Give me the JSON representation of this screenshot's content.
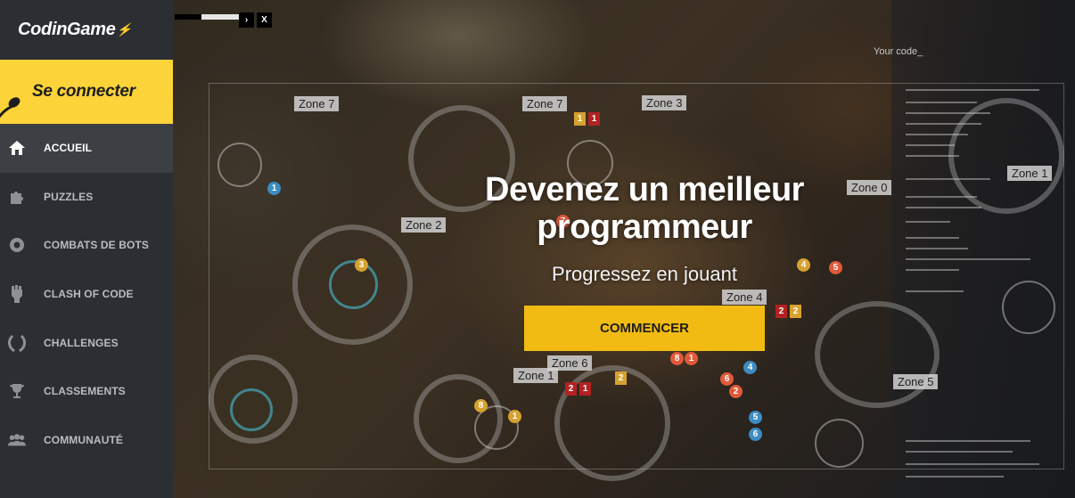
{
  "logo": {
    "text": "CodinGame"
  },
  "sidebar": {
    "connect_label": "Se connecter",
    "items": [
      {
        "label": "ACCUEIL",
        "icon": "home-icon",
        "active": true
      },
      {
        "label": "PUZZLES",
        "icon": "puzzle-icon",
        "active": false
      },
      {
        "label": "COMBATS DE BOTS",
        "icon": "bot-icon",
        "active": false
      },
      {
        "label": "CLASH OF CODE",
        "icon": "fist-icon",
        "active": false
      },
      {
        "label": "CHALLENGES",
        "icon": "laurel-icon",
        "active": false
      },
      {
        "label": "CLASSEMENTS",
        "icon": "trophy-icon",
        "active": false
      },
      {
        "label": "COMMUNAUTÉ",
        "icon": "people-icon",
        "active": false
      }
    ]
  },
  "hero": {
    "title_line1": "Devenez un meilleur",
    "title_line2": "programmeur",
    "subtitle": "Progressez en jouant",
    "cta_label": "COMMENCER",
    "code_label": "Your code_",
    "player_close": "X",
    "player_next": "›",
    "zones": [
      "Zone 7",
      "Zone 7",
      "Zone 3",
      "Zone 2",
      "Zone 0",
      "Zone 1",
      "Zone 4",
      "Zone 6",
      "Zone 1",
      "Zone 5"
    ]
  },
  "colors": {
    "accent": "#f2bb13",
    "connect_bg": "#fdd33a",
    "sidebar_bg": "#2b2f34",
    "sidebar_active": "#3c4045"
  }
}
